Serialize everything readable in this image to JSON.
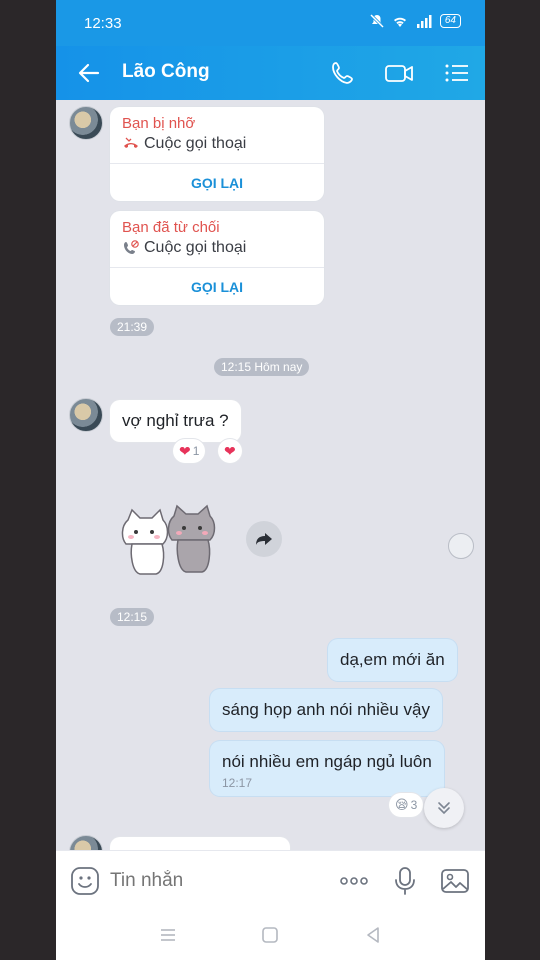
{
  "status": {
    "time": "12:33",
    "battery": "64"
  },
  "header": {
    "title": "Lão Công"
  },
  "messages": {
    "call1": {
      "title": "Bạn bị nhỡ",
      "subtitle": "Cuộc gọi thoại",
      "action": "GỌI LẠI"
    },
    "call2": {
      "title": "Bạn đã từ chối",
      "subtitle": "Cuộc gọi thoại",
      "action": "GỌI LẠI"
    },
    "time1": "21:39",
    "divider": "12:15 Hôm nay",
    "msg1": {
      "text": "vợ nghỉ trưa ?",
      "reaction_count": "1"
    },
    "time2": "12:15",
    "me1": "dạ,em mới ăn",
    "me2": "sáng họp anh nói nhiều vậy",
    "me3": {
      "text": "nói nhiều em ngáp ngủ luôn",
      "time": "12:17"
    },
    "me3_reaction_count": "3"
  },
  "input": {
    "placeholder": "Tin nhắn"
  },
  "colors": {
    "header": "#1a98e6",
    "missed": "#e0534f",
    "action": "#1a90d8",
    "my_bubble": "#d8ecfb"
  }
}
